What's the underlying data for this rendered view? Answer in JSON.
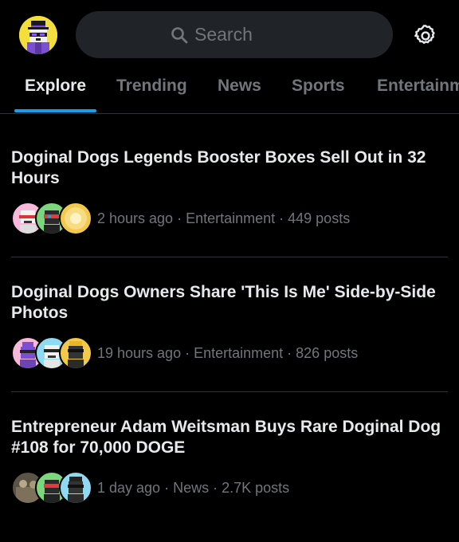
{
  "search": {
    "placeholder": "Search"
  },
  "header": {
    "avatar": "profile-avatar",
    "settings_icon": "gear-icon",
    "search_icon": "search-icon"
  },
  "tabs": [
    {
      "label": "Explore",
      "active": true
    },
    {
      "label": "Trending",
      "active": false
    },
    {
      "label": "News",
      "active": false
    },
    {
      "label": "Sports",
      "active": false
    },
    {
      "label": "Entertainment",
      "active": false
    }
  ],
  "trends": [
    {
      "title": "Doginal Dogs Legends Booster Boxes Sell Out in 32 Hours",
      "time": "2 hours ago",
      "category": "Entertainment",
      "posts": "449 posts",
      "avatar_colors": [
        "#f7b8d9",
        "#7bd67e",
        "#f2c94c"
      ]
    },
    {
      "title": "Doginal Dogs Owners Share 'This Is Me' Side-by-Side Photos",
      "time": "19 hours ago",
      "category": "Entertainment",
      "posts": "826 posts",
      "avatar_colors": [
        "#f7b8d9",
        "#8fd9f2",
        "#f2c94c"
      ]
    },
    {
      "title": "Entrepreneur Adam Weitsman Buys Rare Doginal Dog #108 for 70,000 DOGE",
      "time": "1 day ago",
      "category": "News",
      "posts": "2.7K posts",
      "avatar_colors": [
        "#5a5346",
        "#7bd67e",
        "#8fd9f2"
      ]
    }
  ],
  "colors": {
    "accent": "#1d9bf0",
    "background": "#000000",
    "muted_text": "#71767b",
    "primary_text": "#e7e9ea"
  }
}
